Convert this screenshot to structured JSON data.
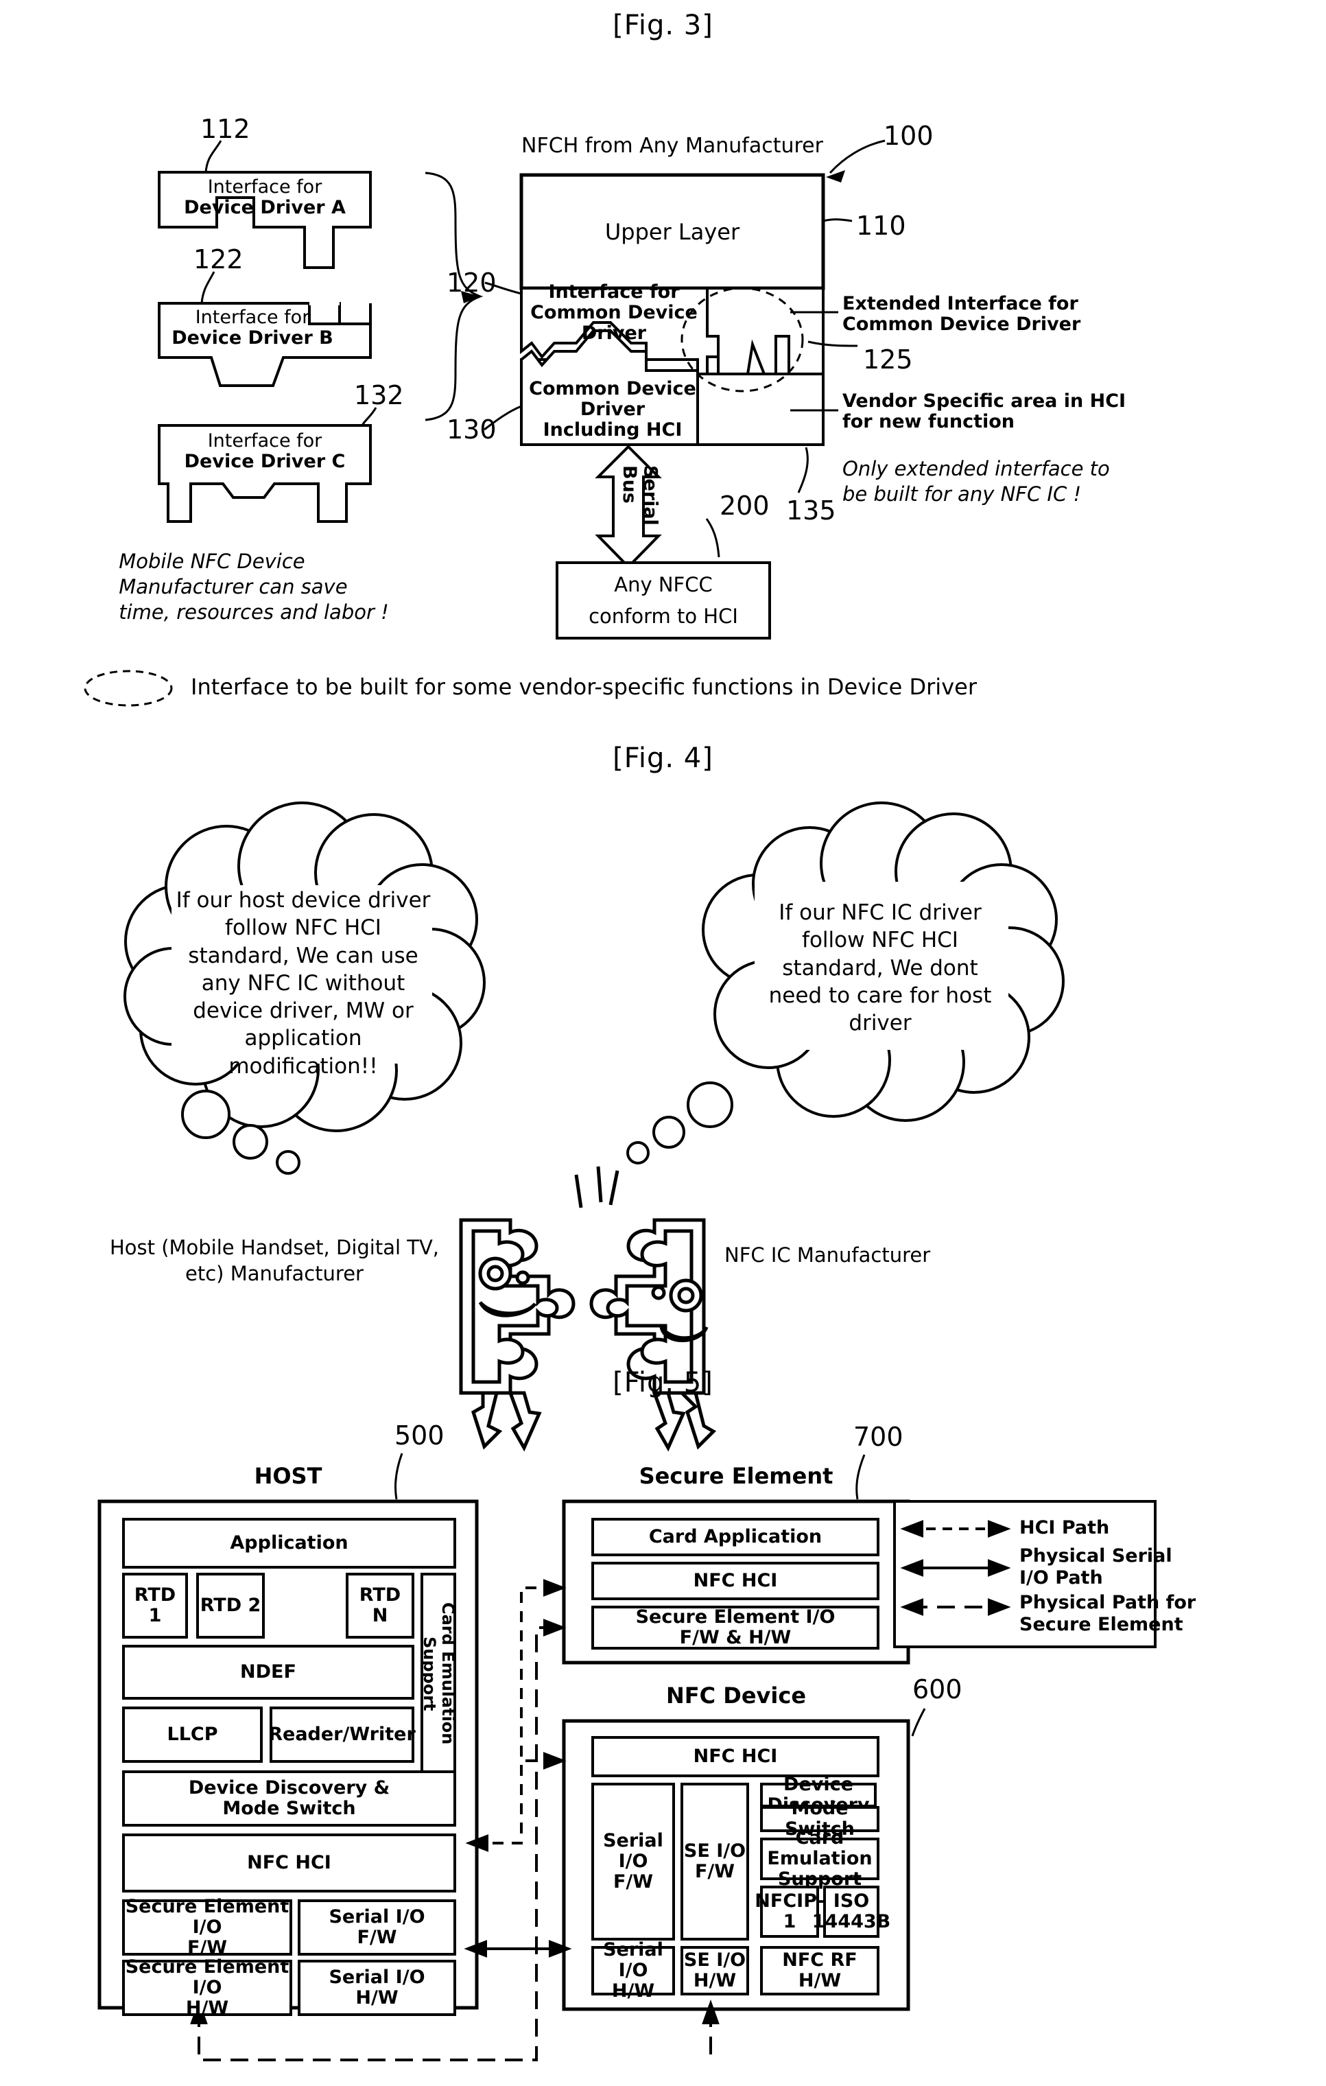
{
  "figures": {
    "fig3": {
      "title": "[Fig. 3]",
      "header_label": "NFCH from Any Manufacturer",
      "refs": {
        "r112": "112",
        "r122": "122",
        "r132": "132",
        "r120": "120",
        "r130": "130",
        "r100": "100",
        "r110": "110",
        "r125": "125",
        "r135": "135",
        "r200": "200"
      },
      "left_blocks": [
        {
          "line1": "Interface for",
          "line2": "Device Driver A"
        },
        {
          "line1": "Interface for",
          "line2": "Device Driver B"
        },
        {
          "line1": "Interface for",
          "line2": "Device Driver C"
        }
      ],
      "upper_layer": "Upper Layer",
      "interface_common": {
        "line1": "Interface for",
        "line2": "Common Device Driver"
      },
      "common_driver": {
        "line1": "Common Device Driver",
        "line2": "Including HCI"
      },
      "annotations": {
        "extended_interface": {
          "line1": "Extended Interface for",
          "line2": "Common Device Driver"
        },
        "vendor_specific": {
          "line1": "Vendor Specific area in HCI",
          "line2": "for new function"
        },
        "only_extended": {
          "line1": "Only extended interface to",
          "line2": "be built for any NFC IC !"
        },
        "mobile_save": {
          "line1": "Mobile NFC Device",
          "line2": "Manufacturer can save",
          "line3": "time, resources and labor !"
        }
      },
      "serial_bus": "Serial Bus",
      "nfcc": {
        "line1": "Any NFCC",
        "line2": "conform to HCI"
      },
      "legend": "Interface  to be built for some vendor-specific functions in Device Driver"
    },
    "fig4": {
      "title": "[Fig. 4]",
      "bubble_left": "If our host device driver follow NFC HCI standard, We can use any NFC IC without device driver, MW or application modification!!",
      "bubble_right": "If our NFC IC driver follow NFC HCI standard,  We dont need to care for host driver",
      "label_left": {
        "line1": "Host (Mobile Handset, Digital TV,",
        "line2": "etc) Manufacturer"
      },
      "label_right": "NFC IC Manufacturer"
    },
    "fig5": {
      "title": "[Fig. 5]",
      "refs": {
        "r500": "500",
        "r700": "700",
        "r600": "600"
      },
      "host": {
        "title": "HOST",
        "application": "Application",
        "rtd": [
          "RTD 1",
          "RTD 2",
          "RTD N"
        ],
        "card_emulation_support": "Card Emulation Support",
        "ndef": "NDEF",
        "llcp": "LLCP",
        "reader_writer": "Reader/Writer",
        "device_discovery": {
          "line1": "Device Discovery &",
          "line2": "Mode Switch"
        },
        "nfc_hci": "NFC HCI",
        "se_io_fw": {
          "line1": "Secure Element I/O",
          "line2": "F/W"
        },
        "serial_io_fw": {
          "line1": "Serial I/O",
          "line2": "F/W"
        },
        "se_io_hw": {
          "line1": "Secure Element I/O",
          "line2": "H/W"
        },
        "serial_io_hw": {
          "line1": "Serial I/O",
          "line2": "H/W"
        }
      },
      "secure_element": {
        "title": "Secure Element",
        "card_application": "Card Application",
        "nfc_hci": "NFC HCI",
        "se_io": {
          "line1": "Secure Element I/O",
          "line2": "F/W & H/W"
        }
      },
      "nfc_device": {
        "title": "NFC Device",
        "nfc_hci": "NFC HCI",
        "serial_io_fw": {
          "line1": "Serial I/O",
          "line2": "F/W"
        },
        "se_io_fw": {
          "line1": "SE I/O",
          "line2": "F/W"
        },
        "device_discovery": "Device Discovery",
        "mode_switch": "Mode Switch",
        "card_emulation": {
          "line1": "Card Emulation",
          "line2": "Support"
        },
        "nfcip1": "NFCIP-1",
        "iso": {
          "line1": "ISO",
          "line2": "14443B"
        },
        "serial_io_hw": {
          "line1": "Serial I/O",
          "line2": "H/W"
        },
        "se_io_hw": {
          "line1": "SE I/O",
          "line2": "H/W"
        },
        "nfc_rf_hw": {
          "line1": "NFC RF",
          "line2": "H/W"
        }
      },
      "legend": [
        {
          "label": "HCI Path",
          "style": "dashed-small"
        },
        {
          "label_line1": "Physical Serial",
          "label_line2": " I/O Path",
          "style": "solid"
        },
        {
          "label_line1": "Physical Path for",
          "label_line2": "Secure Element",
          "style": "dashed-large"
        }
      ]
    }
  },
  "colors": {
    "ink": "#000000",
    "paper": "#ffffff"
  }
}
